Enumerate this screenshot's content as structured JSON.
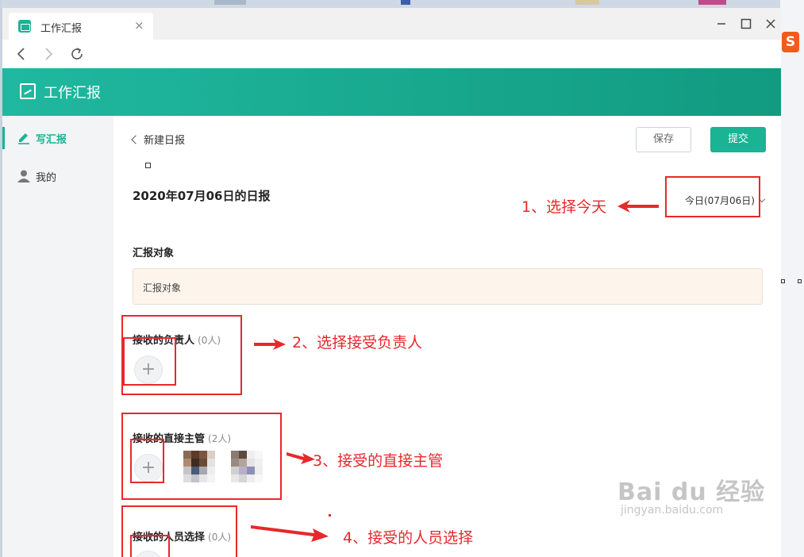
{
  "window": {
    "tab_title": "工作汇报",
    "controls": [
      "minimize",
      "maximize",
      "close"
    ]
  },
  "app": {
    "header_title": "工作汇报",
    "accent": "#1ab394"
  },
  "sidebar": {
    "items": [
      {
        "label": "写汇报",
        "icon": "pencil-icon",
        "active": true
      },
      {
        "label": "我的",
        "icon": "user-icon",
        "active": false
      }
    ]
  },
  "main": {
    "back_label": "新建日报",
    "save_label": "保存",
    "submit_label": "提交",
    "report_title": "2020年07月06日的日报",
    "date_value": "今日(07月06日)",
    "report_target": {
      "label": "汇报对象",
      "placeholder": "汇报对象"
    },
    "sections": [
      {
        "label": "接收的负责人",
        "count": "(0人)"
      },
      {
        "label": "接收的直接主管",
        "count": "(2人)"
      },
      {
        "label": "接收的人员选择",
        "count": "(0人)"
      }
    ]
  },
  "annotations": [
    "1、选择今天",
    "2、选择接受负责人",
    "3、接受的直接主管",
    "4、接受的人员选择"
  ],
  "watermark": {
    "main": "Bai du 经验",
    "sub": "jingyan.baidu.com"
  }
}
